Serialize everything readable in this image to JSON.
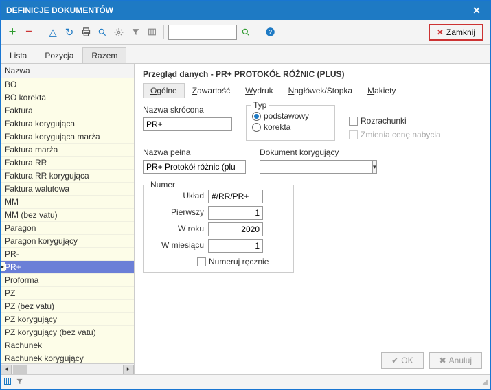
{
  "window": {
    "title": "DEFINICJE DOKUMENTÓW"
  },
  "toolbar": {
    "close_label": "Zamknij",
    "search_value": ""
  },
  "top_tabs": {
    "t0": "Lista",
    "t1": "Pozycja",
    "t2": "Razem",
    "active": 2
  },
  "left": {
    "header": "Nazwa",
    "items": [
      "BO",
      "BO korekta",
      "Faktura",
      "Faktura korygująca",
      "Faktura korygująca marża",
      "Faktura marża",
      "Faktura RR",
      "Faktura RR korygująca",
      "Faktura walutowa",
      "MM",
      "MM (bez vatu)",
      "Paragon",
      "Paragon korygujący",
      "PR-",
      "PR+",
      "Proforma",
      "PZ",
      "PZ (bez vatu)",
      "PZ korygujący",
      "PZ korygujący (bez vatu)",
      "Rachunek",
      "Rachunek korygujący"
    ],
    "selected": "PR+"
  },
  "right": {
    "title": "Przegląd danych - PR+ PROTOKÓŁ RÓŻNIC (PLUS)",
    "sub_tabs": {
      "t0": "Ogólne",
      "t1": "Zawartość",
      "t2": "Wydruk",
      "t3": "Nagłówek/Stopka",
      "t4": "Makiety",
      "active": 0
    },
    "form": {
      "short_label": "Nazwa skrócona",
      "short_value": "PR+",
      "type_legend": "Typ",
      "type_basic": "podstawowy",
      "type_correction": "korekta",
      "settlements": "Rozrachunki",
      "changes_price": "Zmienia cenę nabycia",
      "full_label": "Nazwa pełna",
      "full_value": "PR+ Protokół różnic (plu",
      "corr_doc_label": "Dokument korygujący",
      "corr_doc_value": "",
      "numer_legend": "Numer",
      "uklad_label": "Układ",
      "uklad_value": "#/RR/PR+",
      "first_label": "Pierwszy",
      "first_value": "1",
      "year_label": "W roku",
      "year_value": "2020",
      "month_label": "W miesiącu",
      "month_value": "1",
      "manual_label": "Numeruj ręcznie"
    },
    "buttons": {
      "ok": "OK",
      "cancel": "Anuluj"
    }
  }
}
